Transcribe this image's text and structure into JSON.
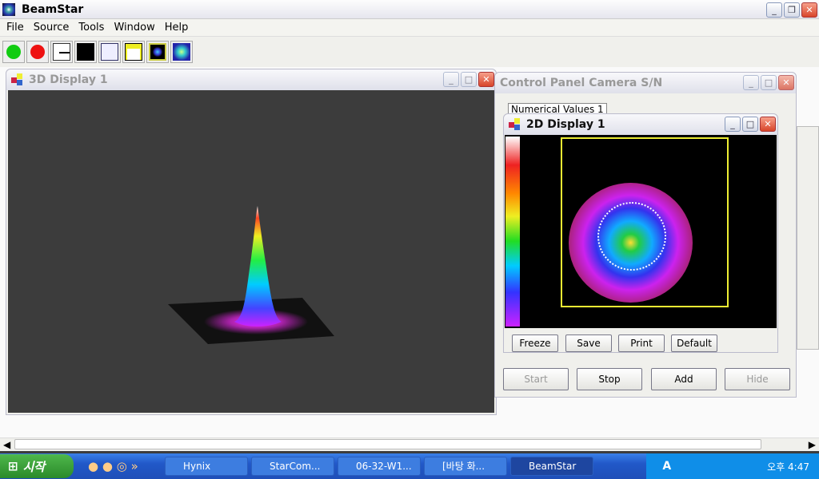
{
  "app": {
    "title": "BeamStar"
  },
  "menu": [
    "File",
    "Source",
    "Tools",
    "Window",
    "Help"
  ],
  "toolbar": [
    "start-green",
    "stop-red",
    "profile",
    "noise",
    "calibration",
    "report",
    "2d-view",
    "beam-view"
  ],
  "win3d": {
    "title": "3D Display 1"
  },
  "control": {
    "title": "Control Panel Camera S/N",
    "tab": "Numerical Values 1",
    "buttons": [
      "Start",
      "Stop",
      "Add",
      "Hide"
    ]
  },
  "win2d": {
    "title": "2D Display 1",
    "buttons": [
      "Freeze",
      "Save",
      "Print",
      "Default"
    ]
  },
  "taskbar": {
    "start": "시작",
    "items": [
      "Hynix",
      "StarCom...",
      "06-32-W1...",
      "[바탕 화...",
      "BeamStar"
    ],
    "clock": "오후 4:47",
    "lang": "A"
  }
}
